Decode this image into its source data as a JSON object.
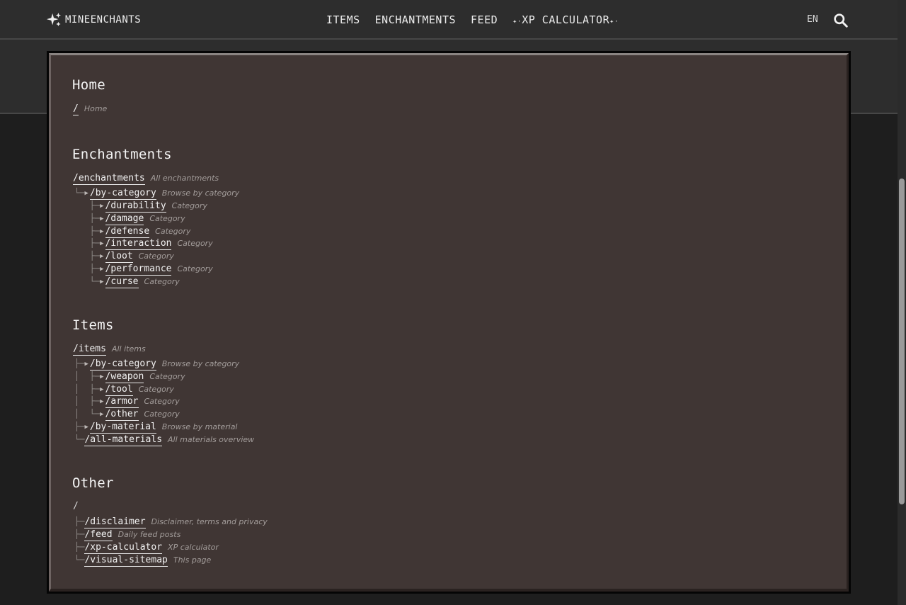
{
  "header": {
    "logo_text": "MINEENCHANTS",
    "logo_icon": "sparkles-icon",
    "nav": {
      "items": "ITEMS",
      "enchantments": "ENCHANTMENTS",
      "feed": "FEED",
      "xp_sparkle_left": "✦·",
      "xp_calculator": "XP CALCULATOR",
      "xp_sparkle_right": "✦·"
    },
    "lang": "EN",
    "search_icon": "search-icon"
  },
  "sitemap": {
    "home": {
      "title": "Home",
      "root_link": "/",
      "root_desc": "Home"
    },
    "enchantments": {
      "title": "Enchantments",
      "root_link": "/enchantments",
      "root_desc": "All enchantments",
      "by_category": {
        "link": "/by-category",
        "desc": "Browse by category"
      },
      "children": [
        {
          "link": "/durability",
          "desc": "Category"
        },
        {
          "link": "/damage",
          "desc": "Category"
        },
        {
          "link": "/defense",
          "desc": "Category"
        },
        {
          "link": "/interaction",
          "desc": "Category"
        },
        {
          "link": "/loot",
          "desc": "Category"
        },
        {
          "link": "/performance",
          "desc": "Category"
        },
        {
          "link": "/curse",
          "desc": "Category"
        }
      ]
    },
    "items": {
      "title": "Items",
      "root_link": "/items",
      "root_desc": "All items",
      "by_category": {
        "link": "/by-category",
        "desc": "Browse by category"
      },
      "children": [
        {
          "link": "/weapon",
          "desc": "Category"
        },
        {
          "link": "/tool",
          "desc": "Category"
        },
        {
          "link": "/armor",
          "desc": "Category"
        },
        {
          "link": "/other",
          "desc": "Category"
        }
      ],
      "by_material": {
        "link": "/by-material",
        "desc": "Browse by material"
      },
      "all_materials": {
        "link": "/all-materials",
        "desc": "All materials overview"
      }
    },
    "other": {
      "title": "Other",
      "root_link": "/",
      "children": [
        {
          "link": "/disclaimer",
          "desc": "Disclaimer, terms and privacy"
        },
        {
          "link": "/feed",
          "desc": "Daily feed posts"
        },
        {
          "link": "/xp-calculator",
          "desc": "XP calculator"
        },
        {
          "link": "/visual-sitemap",
          "desc": "This page"
        }
      ]
    }
  }
}
